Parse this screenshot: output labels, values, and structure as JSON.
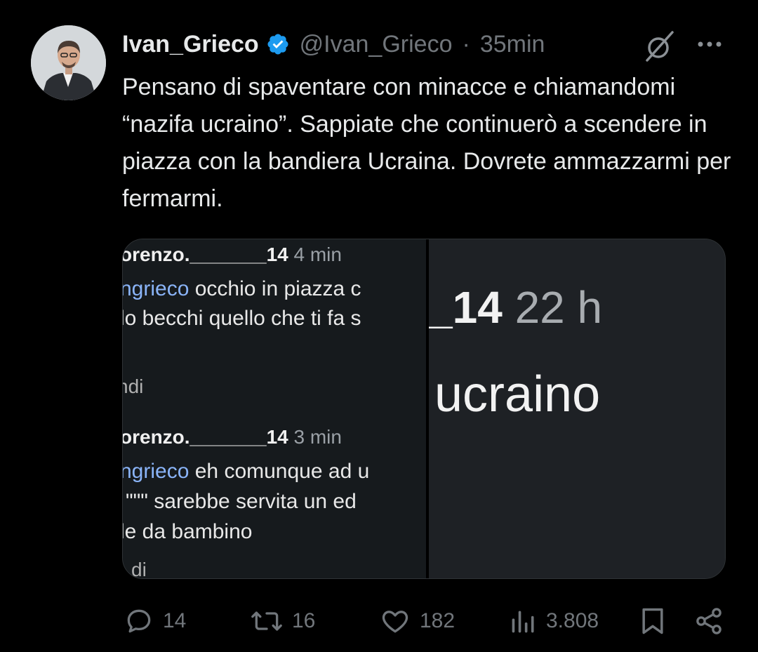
{
  "tweet": {
    "display_name": "Ivan_Grieco",
    "handle": "@Ivan_Grieco",
    "separator": "·",
    "time": "35min",
    "text": "Pensano di spaventare con minacce e chiamandomi “nazifa ucraino”. Sappiate che continuerò a scendere in piazza con la bandiera Ucraina. Dovrete ammazzarmi per fermarmi."
  },
  "media": {
    "left": {
      "c1_user": "orenzo._______14",
      "c1_time": "4 min",
      "c1_mention": "ngrieco",
      "c1_line1": " occhio in piazza c",
      "c1_line2": "lo becchi quello che ti fa s",
      "c1_reply": "ndi",
      "c2_user": "orenzo._______14",
      "c2_time": "3 min",
      "c2_mention": "ngrieco",
      "c2_line1": " eh comunque ad u",
      "c2_line2": "\"\"\" sarebbe servita un ed",
      "c2_line3": "le da bambino",
      "c2_reply": "di"
    },
    "right": {
      "user_fragment": "_14",
      "time": "22 h",
      "word": "ucraino"
    }
  },
  "actions": {
    "replies": "14",
    "retweets": "16",
    "likes": "182",
    "views": "3.808"
  },
  "colors": {
    "background": "#000000",
    "text": "#e7e9ea",
    "muted": "#71767b",
    "verified": "#1d9bf0",
    "mention": "#8ab4f8"
  },
  "icons": [
    "avatar",
    "verified-badge-icon",
    "grok-icon",
    "more-icon",
    "reply-icon",
    "retweet-icon",
    "like-icon",
    "views-icon",
    "bookmark-icon",
    "share-icon"
  ]
}
